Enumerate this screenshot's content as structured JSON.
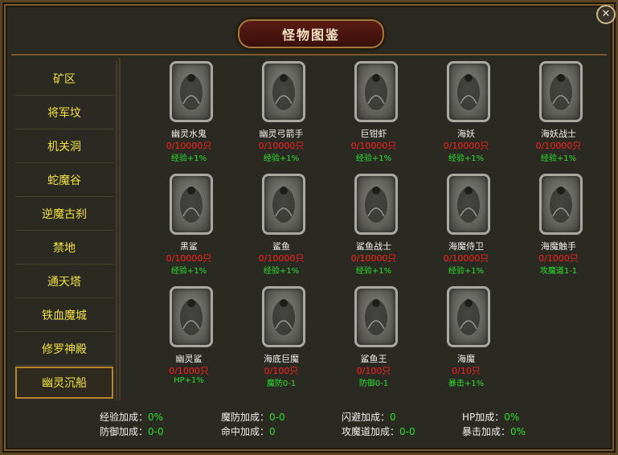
{
  "window": {
    "title": "怪物图鉴",
    "close_label": "✕"
  },
  "sidebar": {
    "items": [
      {
        "label": "矿区"
      },
      {
        "label": "将军坟"
      },
      {
        "label": "机关洞"
      },
      {
        "label": "蛇魔谷"
      },
      {
        "label": "逆魔古刹"
      },
      {
        "label": "禁地"
      },
      {
        "label": "通天塔"
      },
      {
        "label": "铁血魔城"
      },
      {
        "label": "修罗神殿"
      },
      {
        "label": "幽灵沉船"
      }
    ],
    "active_index": 9
  },
  "monsters": [
    {
      "name": "幽灵水鬼",
      "current": "0",
      "total": "/10000只",
      "bonus": "经验+1%",
      "icon": "ghost-diver-icon"
    },
    {
      "name": "幽灵弓箭手",
      "current": "0",
      "total": "/10000只",
      "bonus": "经验+1%",
      "icon": "ghost-archer-icon"
    },
    {
      "name": "巨钳虾",
      "current": "0",
      "total": "/10000只",
      "bonus": "经验+1%",
      "icon": "giant-shrimp-icon"
    },
    {
      "name": "海妖",
      "current": "0",
      "total": "/10000只",
      "bonus": "经验+1%",
      "icon": "siren-icon"
    },
    {
      "name": "海妖战士",
      "current": "0",
      "total": "/10000只",
      "bonus": "经验+1%",
      "icon": "siren-warrior-icon"
    },
    {
      "name": "黑鲨",
      "current": "0",
      "total": "/10000只",
      "bonus": "经验+1%",
      "icon": "black-shark-icon"
    },
    {
      "name": "鲨鱼",
      "current": "0",
      "total": "/10000只",
      "bonus": "经验+1%",
      "icon": "shark-icon"
    },
    {
      "name": "鲨鱼战士",
      "current": "0",
      "total": "/10000只",
      "bonus": "经验+1%",
      "icon": "shark-warrior-icon"
    },
    {
      "name": "海魔侍卫",
      "current": "0",
      "total": "/10000只",
      "bonus": "经验+1%",
      "icon": "sea-demon-guard-icon"
    },
    {
      "name": "海魔触手",
      "current": "0",
      "total": "/1000只",
      "bonus": "攻魔道1-1",
      "icon": "sea-demon-tentacle-icon"
    },
    {
      "name": "幽灵鲨",
      "current": "0",
      "total": "/1000只",
      "bonus": "HP+1%",
      "icon": "ghost-shark-icon"
    },
    {
      "name": "海底巨魔",
      "current": "0",
      "total": "/100只",
      "bonus": "魔防0-1",
      "icon": "deep-sea-troll-icon"
    },
    {
      "name": "鲨鱼王",
      "current": "0",
      "total": "/100只",
      "bonus": "防御0-1",
      "icon": "shark-king-icon"
    },
    {
      "name": "海魔",
      "current": "0",
      "total": "/10只",
      "bonus": "暴击+1%",
      "icon": "sea-demon-icon"
    }
  ],
  "stats": [
    {
      "label": "经验加成：",
      "value": "0%"
    },
    {
      "label": "魔防加成：",
      "value": "0-0"
    },
    {
      "label": "闪避加成：",
      "value": "0"
    },
    {
      "label": "HP加成：",
      "value": "0%"
    },
    {
      "label": "防御加成：",
      "value": "0-0"
    },
    {
      "label": "命中加成：",
      "value": "0"
    },
    {
      "label": "攻魔道加成：",
      "value": "0-0"
    },
    {
      "label": "暴击加成：",
      "value": "0%"
    }
  ]
}
